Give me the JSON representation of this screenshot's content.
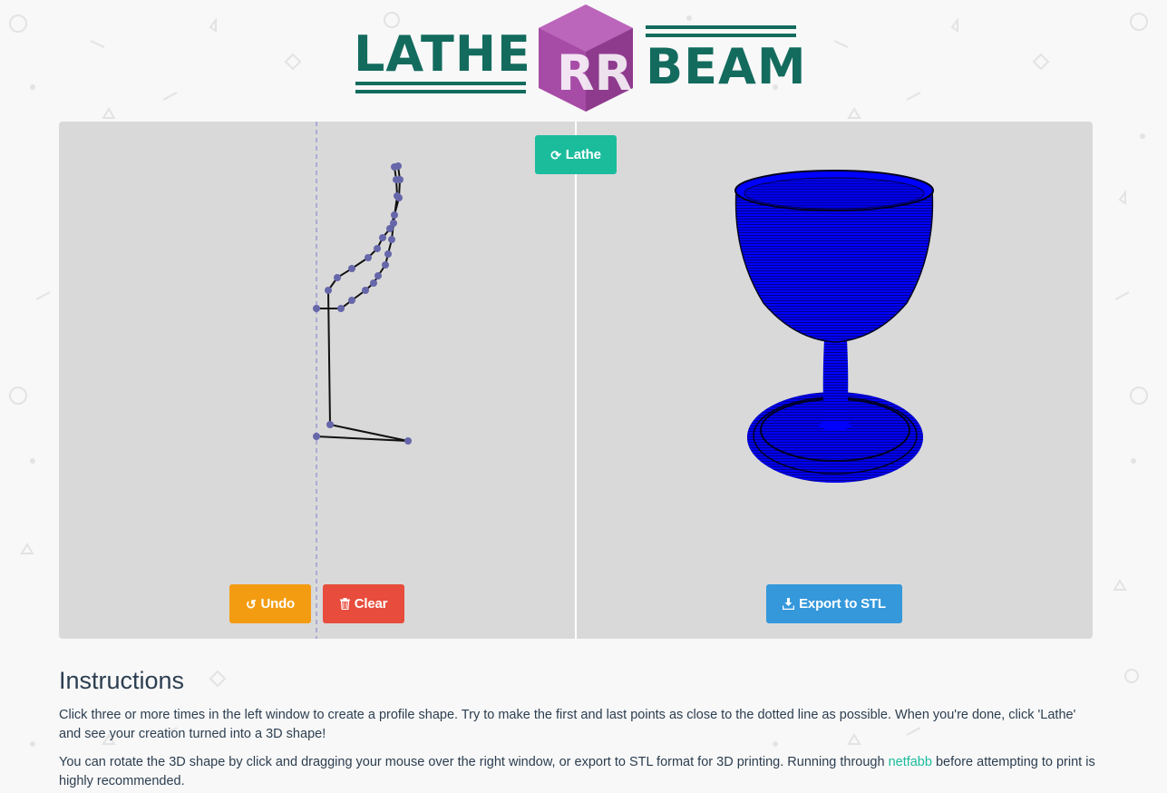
{
  "header": {
    "logo_left": "LATHE",
    "logo_right": "BEAM",
    "logo_badge": "RR",
    "brand_colors": {
      "primary": "#136b5e",
      "badge": "#a64ca6"
    }
  },
  "workspace": {
    "lathe_label": "Lathe",
    "lathe_icon": "refresh-icon",
    "undo_label": "Undo",
    "undo_icon": "undo-icon",
    "clear_label": "Clear",
    "clear_icon": "trash-icon",
    "export_label": "Export to STL",
    "export_icon": "download-icon",
    "colors": {
      "panel": "#d9d9d9",
      "teal": "#1abc9c",
      "orange": "#f39c12",
      "red": "#e74c3c",
      "blue": "#3498db",
      "mesh": "#0000ff",
      "point": "#6666aa"
    }
  },
  "instructions": {
    "title": "Instructions",
    "para1": "Click three or more times in the left window to create a profile shape. Try to make the first and last points as close to the dotted line as possible. When you're done, click 'Lathe' and see your creation turned into a 3D shape!",
    "para2_before": "You can rotate the 3D shape by click and dragging your mouse over the right window, or export to STL format for 3D printing. Running through ",
    "para2_link": "netfabb",
    "para2_after": " before attempting to print is highly recommended."
  }
}
